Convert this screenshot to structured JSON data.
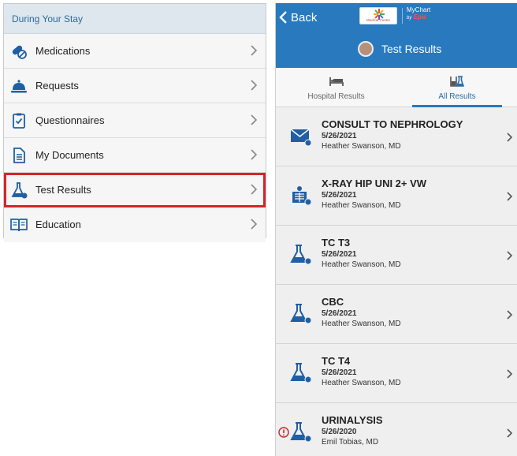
{
  "left_menu": {
    "section_title": "During Your Stay",
    "items": [
      {
        "label": "Medications",
        "icon": "pills-icon"
      },
      {
        "label": "Requests",
        "icon": "service-bell-icon"
      },
      {
        "label": "Questionnaires",
        "icon": "clipboard-check-icon"
      },
      {
        "label": "My Documents",
        "icon": "document-icon"
      },
      {
        "label": "Test Results",
        "icon": "flask-icon",
        "highlighted": true
      },
      {
        "label": "Education",
        "icon": "book-icon"
      }
    ],
    "highlight_color": "#d6242c"
  },
  "right_panel": {
    "back_label": "Back",
    "logo_text": "Medical Center",
    "mychart_logo": {
      "line1": "MyChart",
      "by": "by",
      "brand": "Epic"
    },
    "title": "Test Results",
    "tabs": [
      {
        "label": "Hospital Results",
        "icon": "hospital-bed-icon",
        "selected": false
      },
      {
        "label": "All Results",
        "icon": "lab-beakers-icon",
        "selected": true
      }
    ],
    "results": [
      {
        "title": "CONSULT TO NEPHROLOGY",
        "date": "5/26/2021",
        "doctor": "Heather Swanson, MD",
        "icon": "envelope-icon",
        "alert": false
      },
      {
        "title": "X-RAY HIP UNI 2+ VW",
        "date": "5/26/2021",
        "doctor": "Heather Swanson, MD",
        "icon": "xray-icon",
        "alert": false
      },
      {
        "title": "TC T3",
        "date": "5/26/2021",
        "doctor": "Heather Swanson, MD",
        "icon": "flask-icon",
        "alert": false
      },
      {
        "title": "CBC",
        "date": "5/26/2021",
        "doctor": "Heather Swanson, MD",
        "icon": "flask-icon",
        "alert": false
      },
      {
        "title": "TC T4",
        "date": "5/26/2021",
        "doctor": "Heather Swanson, MD",
        "icon": "flask-icon",
        "alert": false
      },
      {
        "title": "URINALYSIS",
        "date": "5/26/2020",
        "doctor": "Emil Tobias, MD",
        "icon": "flask-icon",
        "alert": true
      }
    ]
  },
  "colors": {
    "header_blue": "#2879bd",
    "icon_blue": "#1f5fa5",
    "alert_red": "#c0272d"
  }
}
